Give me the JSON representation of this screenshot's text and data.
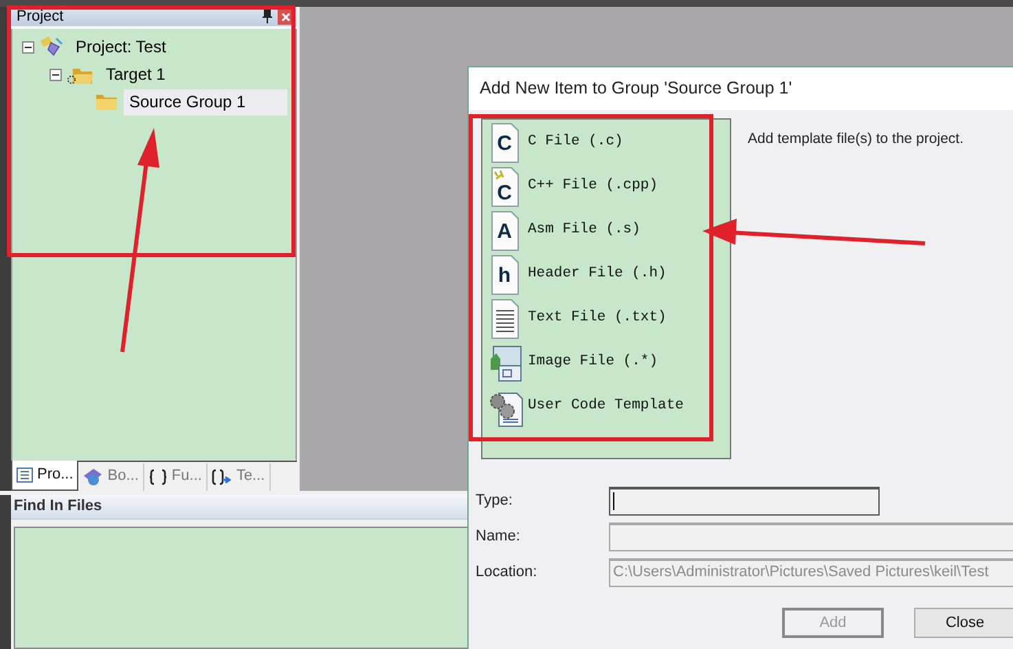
{
  "project_panel": {
    "title": "Project",
    "tree": [
      {
        "label": "Project: Test",
        "kind": "project",
        "expanded": true,
        "selected": false,
        "children": [
          {
            "label": "Target 1",
            "kind": "target",
            "expanded": true,
            "selected": false,
            "children": [
              {
                "label": "Source Group 1",
                "kind": "group",
                "selected": true
              }
            ]
          }
        ]
      }
    ],
    "tabs": [
      {
        "label": "Pro...",
        "kind": "project",
        "selected": true
      },
      {
        "label": "Bo...",
        "kind": "books",
        "selected": false
      },
      {
        "label": "Fu...",
        "kind": "functions",
        "selected": false
      },
      {
        "label": "Te...",
        "kind": "templates",
        "selected": false
      }
    ]
  },
  "find_panel": {
    "title": "Find In Files"
  },
  "dialog": {
    "title": "Add New Item to Group 'Source Group 1'",
    "items": [
      {
        "label": "C File (.c)",
        "kind": "letter",
        "glyph": "C"
      },
      {
        "label": "C++ File (.cpp)",
        "kind": "cpp",
        "glyph": "C"
      },
      {
        "label": "Asm File (.s)",
        "kind": "letter",
        "glyph": "A"
      },
      {
        "label": "Header File (.h)",
        "kind": "letter",
        "glyph": "h"
      },
      {
        "label": "Text File (.txt)",
        "kind": "text"
      },
      {
        "label": "Image File (.*)",
        "kind": "image"
      },
      {
        "label": "User Code Template",
        "kind": "template"
      }
    ],
    "description": "Add template file(s) to the project.",
    "fields": [
      {
        "label": "Type:",
        "focused": true
      },
      {
        "label": "Name:",
        "focused": false
      },
      {
        "label": "Location:",
        "value": "C:\\Users\\Administrator\\Pictures\\Saved Pictures\\keil\\Test",
        "focused": false,
        "disabled": true
      }
    ],
    "buttons": [
      {
        "label": "Add",
        "disabled": true
      },
      {
        "label": "Close",
        "disabled": false
      }
    ]
  }
}
